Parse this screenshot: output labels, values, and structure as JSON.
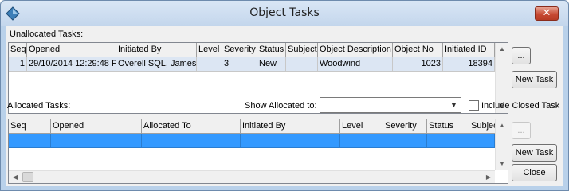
{
  "window": {
    "title": "Object Tasks"
  },
  "unallocated": {
    "label": "Unallocated Tasks:",
    "columns": [
      "Seq",
      "Opened",
      "Initiated By",
      "Level",
      "Severity",
      "Status",
      "Subject",
      "Object Description",
      "Object No",
      "Initiated ID"
    ],
    "rows": [
      {
        "seq": "1",
        "opened": "29/10/2014 12:29:48 P",
        "initiated_by": "Overell SQL, James",
        "level": "",
        "severity": "3",
        "status": "New",
        "subject": "",
        "object_description": "Woodwind",
        "object_no": "1023",
        "initiated_id": "18394"
      }
    ],
    "ellipsis_label": "...",
    "new_task_label": "New Task"
  },
  "allocated": {
    "label": "Allocated Tasks:",
    "show_allocated_label": "Show Allocated to:",
    "show_allocated_value": "",
    "include_closed_label": "Include Closed Task",
    "include_closed_checked": false,
    "columns": [
      "Seq",
      "Opened",
      "Allocated To",
      "Initiated By",
      "Level",
      "Severity",
      "Status",
      "Subject"
    ],
    "ellipsis_label": "...",
    "new_task_label": "New Task",
    "close_label": "Close"
  }
}
